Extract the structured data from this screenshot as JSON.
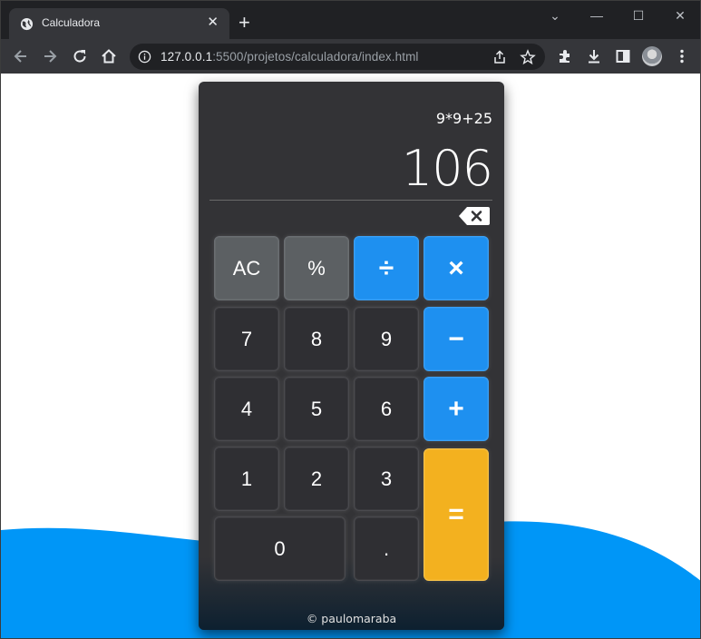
{
  "browser": {
    "tab_title": "Calculadora",
    "tab_close": "✕",
    "new_tab": "+",
    "url_host": "127.0.0.1",
    "url_rest": ":5500/projetos/calculadora/index.html",
    "window_controls": [
      "⌄",
      "—",
      "☐",
      "✕"
    ]
  },
  "calculator": {
    "expression": "9*9+25",
    "result": "106",
    "buttons": {
      "ac": "AC",
      "percent": "%",
      "divide": "÷",
      "multiply": "×",
      "seven": "7",
      "eight": "8",
      "nine": "9",
      "minus": "−",
      "four": "4",
      "five": "5",
      "six": "6",
      "plus": "+",
      "one": "1",
      "two": "2",
      "three": "3",
      "equals": "=",
      "zero": "0",
      "dot": "."
    },
    "footer": "© paulomaraba"
  },
  "colors": {
    "operator": "#1e90f0",
    "equals": "#f3b11f",
    "function": "#5c6063",
    "number": "#2f2f33",
    "wave": "#0096f7"
  }
}
